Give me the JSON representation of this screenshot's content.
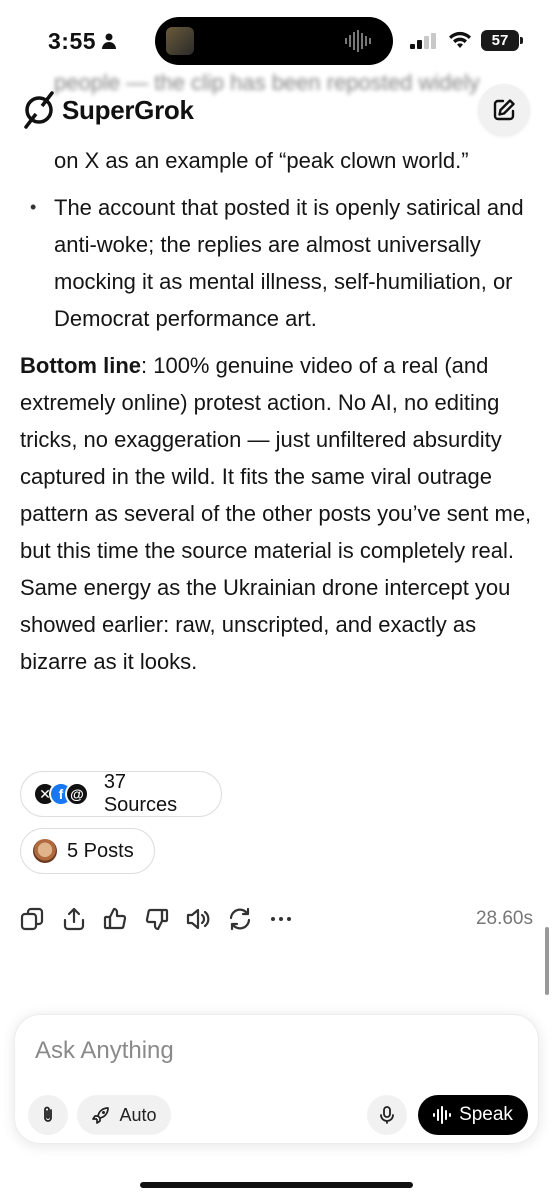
{
  "status_bar": {
    "time": "3:55",
    "battery": "57"
  },
  "header": {
    "app_name": "SuperGrok"
  },
  "message": {
    "faded_lines": [
      "people — the clip has been reposted widely"
    ],
    "first_bullet_tail": "on X as an example of “peak clown world.”",
    "bullets": [
      "The account that posted it is openly satirical and anti-woke; the replies are almost universally mocking it as mental illness, self-humiliation, or Democrat performance art."
    ],
    "bottom_line_label": "Bottom line",
    "bottom_line_text": ": 100% genuine video of a real (and extremely online) protest action. No AI, no editing tricks, no exaggeration — just unfiltered absurdity captured in the wild. It fits the same viral outrage pattern as several of the other posts you’ve sent me, but this time the source material is completely real. Same energy as the Ukrainian drone intercept you showed earlier: raw, unscripted, and exactly as bizarre as it looks."
  },
  "chips": {
    "sources_label": "37 Sources",
    "posts_label": "5 Posts"
  },
  "actions": {
    "icons": [
      "copy-icon",
      "share-icon",
      "thumbs-up-icon",
      "thumbs-down-icon",
      "speaker-icon",
      "regenerate-icon",
      "more-icon"
    ],
    "elapsed": "28.60s"
  },
  "composer": {
    "placeholder": "Ask Anything",
    "value": "",
    "mode_label": "Auto",
    "speak_label": "Speak"
  },
  "colors": {
    "accent": "#000000",
    "muted": "#8a8a8a",
    "chip_border": "#dedede",
    "facebook": "#1877f2"
  }
}
